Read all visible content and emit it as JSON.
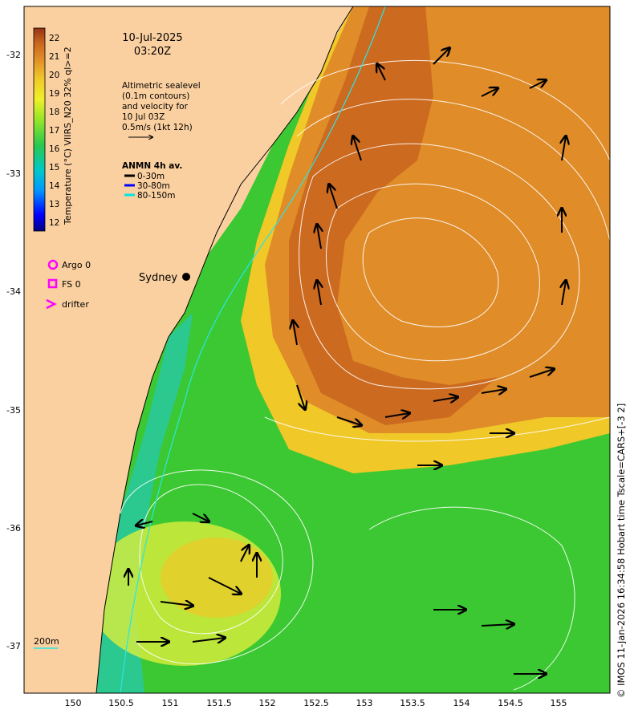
{
  "date": "10-Jul-2025",
  "time": "03:20Z",
  "colorbar": {
    "label": "Temperature (°C) VIIRS_N20 32% ql>=2",
    "ticks": [
      "12",
      "13",
      "14",
      "15",
      "16",
      "17",
      "18",
      "19",
      "20",
      "21",
      "22"
    ]
  },
  "altimetry": {
    "line1": "Altimetric sealevel",
    "line2": "(0.1m contours)",
    "line3": "and velocity for",
    "line4": "10 Jul 03Z",
    "scale": "0.5m/s (1kt 12h)"
  },
  "anmn": {
    "title": "ANMN 4h av.",
    "items": [
      {
        "label": "0-30m",
        "color": "#000000"
      },
      {
        "label": "30-80m",
        "color": "#0000ff"
      },
      {
        "label": "80-150m",
        "color": "#00e5e5"
      }
    ]
  },
  "markers": {
    "argo": "Argo 0",
    "fs": "FS 0",
    "drifter": "drifter",
    "marker_color": "#ff00ff"
  },
  "city": "Sydney",
  "isobath": "200m",
  "lat_labels": [
    "-32",
    "-33",
    "-34",
    "-35",
    "-36",
    "-37"
  ],
  "lon_labels": [
    "150",
    "150.5",
    "151",
    "151.5",
    "152",
    "152.5",
    "153",
    "153.5",
    "154",
    "154.5",
    "155"
  ],
  "footer": "© IMOS 11-Jan-2026 16:34:58 Hobart time Tscale=CARS+[-3 2]",
  "colors": {
    "land": "#fbd0a0",
    "warm_core": "#c8641e",
    "warm": "#e08c28",
    "mid": "#f0c828",
    "cool": "#3cc832",
    "coastal": "#28c8a0"
  }
}
